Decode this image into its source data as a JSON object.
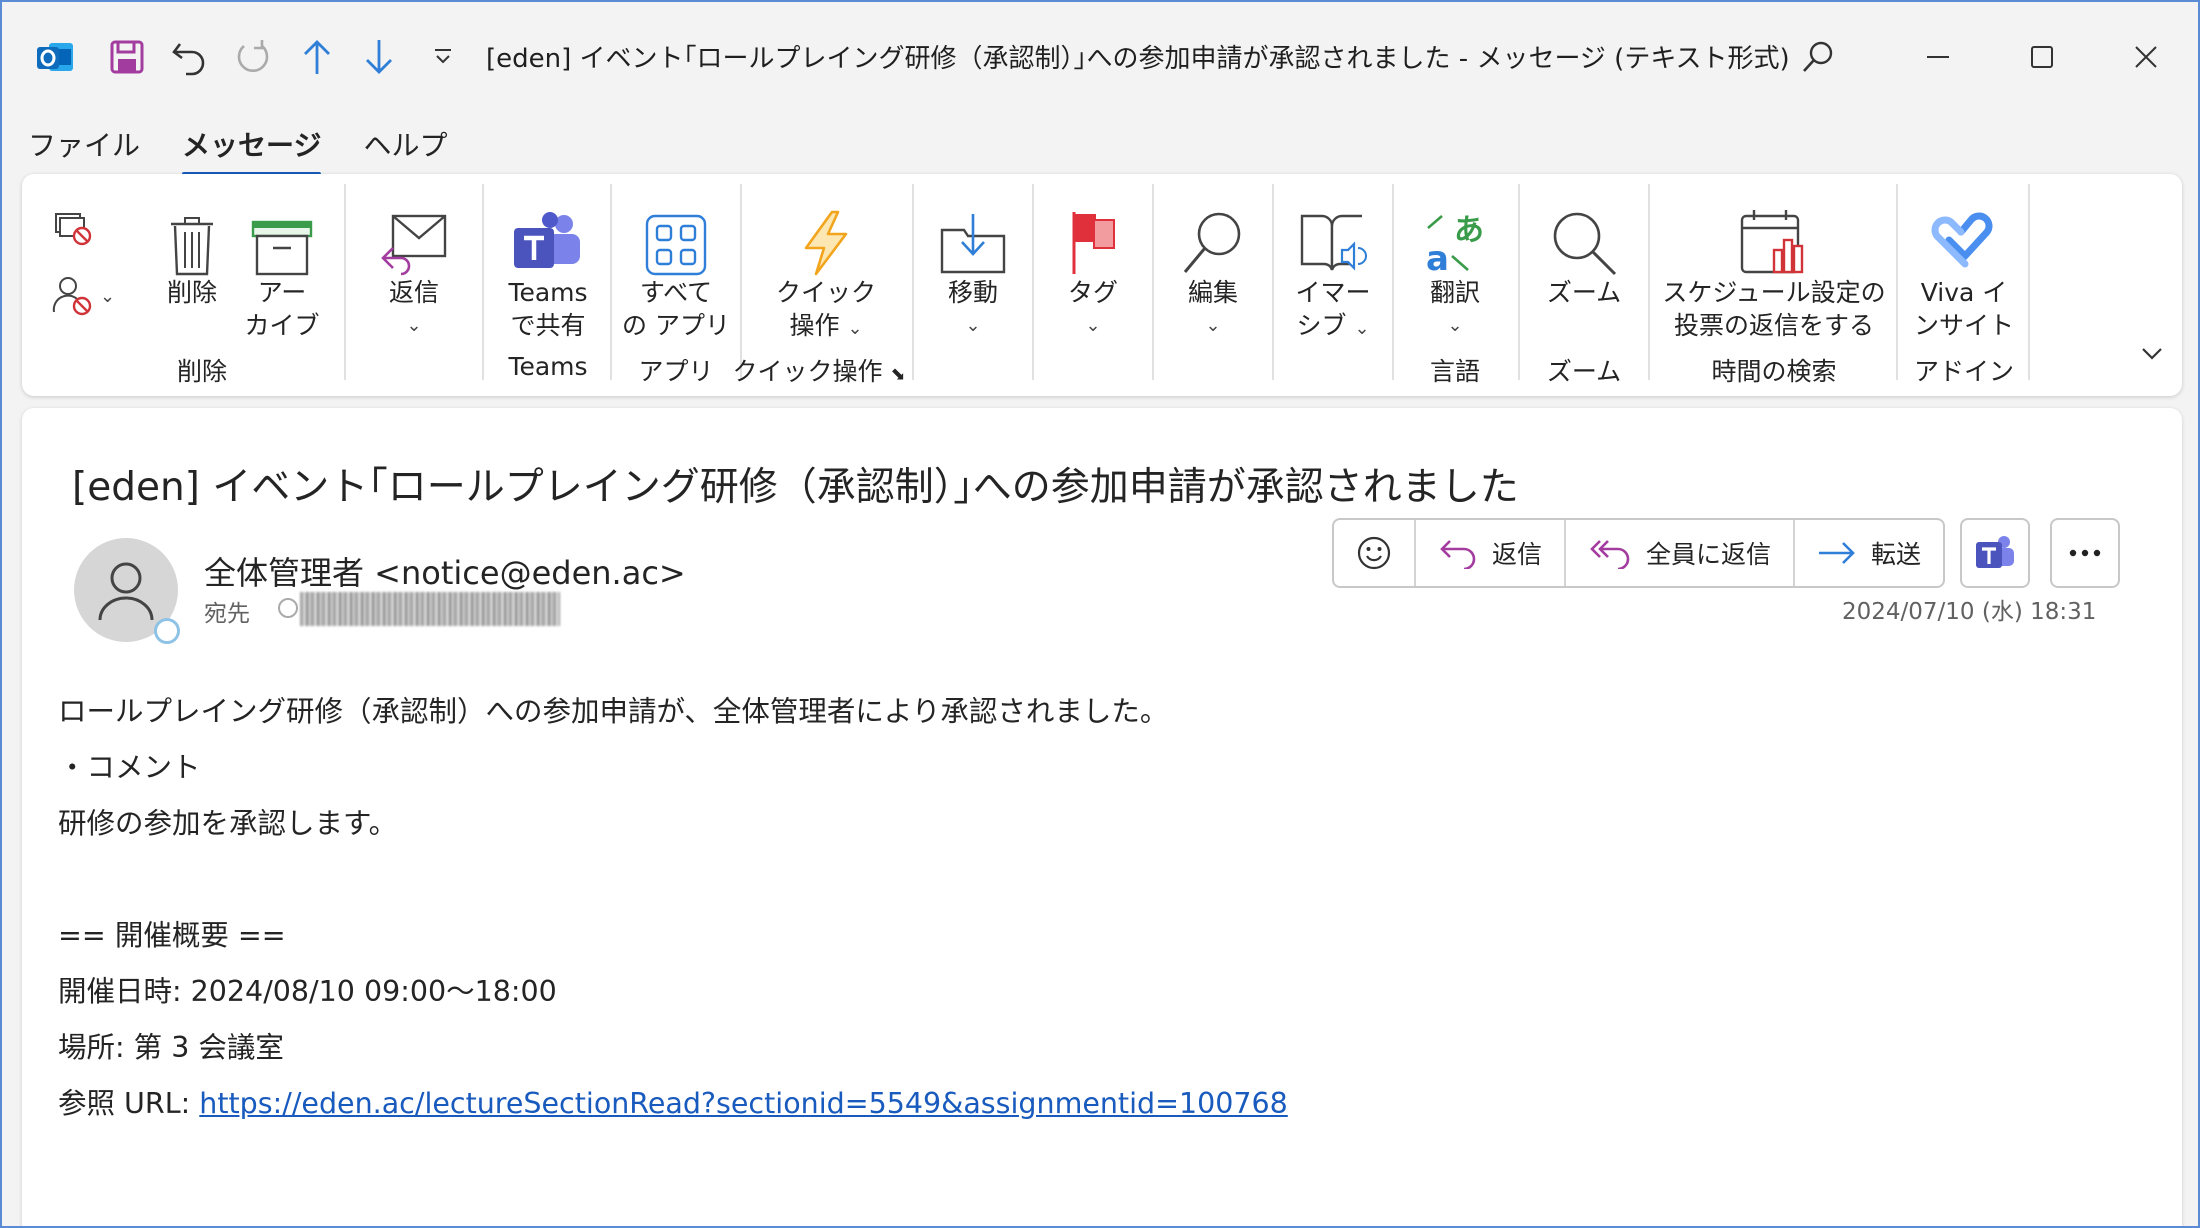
{
  "title_bar": {
    "title": "[eden] イベント｢ロールプレイング研修（承認制）｣への参加申請が承認されました  -  メッセージ (テキスト形式)",
    "icons": [
      "outlook-icon",
      "save-icon",
      "undo-icon",
      "redo-icon",
      "up-arrow-icon",
      "down-arrow-icon",
      "customize-qat-icon",
      "search-icon",
      "minimize-icon",
      "maximize-icon",
      "close-icon"
    ]
  },
  "menu": {
    "tabs": [
      "ファイル",
      "メッセージ",
      "ヘルプ"
    ],
    "active": "メッセージ"
  },
  "ribbon": {
    "delete_label": "削除",
    "archive_label_1": "アー",
    "archive_label_2": "カイブ",
    "group_delete": "削除",
    "reply_label": "返信",
    "teams_label_1": "Teams",
    "teams_label_2": "で共有",
    "group_teams": "Teams",
    "apps_label_1": "すべて",
    "apps_label_2": "の アプリ",
    "group_apps": "アプリ",
    "quick_label_1": "クイック",
    "quick_label_2": "操作",
    "group_quick": "クイック操作",
    "move_label": "移動",
    "tag_label": "タグ",
    "edit_label": "編集",
    "immersive_label_1": "イマー",
    "immersive_label_2": "シブ",
    "translate_label": "翻訳",
    "group_language": "言語",
    "zoom_label": "ズーム",
    "group_zoom": "ズーム",
    "schedule_label_1": "スケジュール設定の",
    "schedule_label_2": "投票の返信をする",
    "group_time": "時間の検索",
    "viva_label_1": "Viva イ",
    "viva_label_2": "ンサイト",
    "group_addin": "アドイン",
    "colors": {
      "accent": "#185abd",
      "teams": "#5059c9",
      "flag": "#e0303b",
      "quick": "#f2a51c"
    }
  },
  "message": {
    "subject": "[eden] イベント｢ロールプレイング研修（承認制）｣への参加申請が承認されました",
    "sender": "全体管理者 <notice@eden.ac>",
    "to_label": "宛先",
    "date": "2024/07/10 (水) 18:31",
    "actions": {
      "reply": "返信",
      "reply_all": "全員に返信",
      "forward": "転送"
    },
    "body": {
      "line1": "ロールプレイング研修（承認制）への参加申請が、全体管理者により承認されました。",
      "line2": "・コメント",
      "line3": "研修の参加を承認します。",
      "line4": "",
      "line5": "== 開催概要 ==",
      "line6": "開催日時: 2024/08/10 09:00～18:00",
      "line7": "場所:  第 3 会議室",
      "line8_label": "参照 URL: ",
      "url": "https://eden.ac/lectureSectionRead?sectionid=5549&assignmentid=100768"
    }
  }
}
